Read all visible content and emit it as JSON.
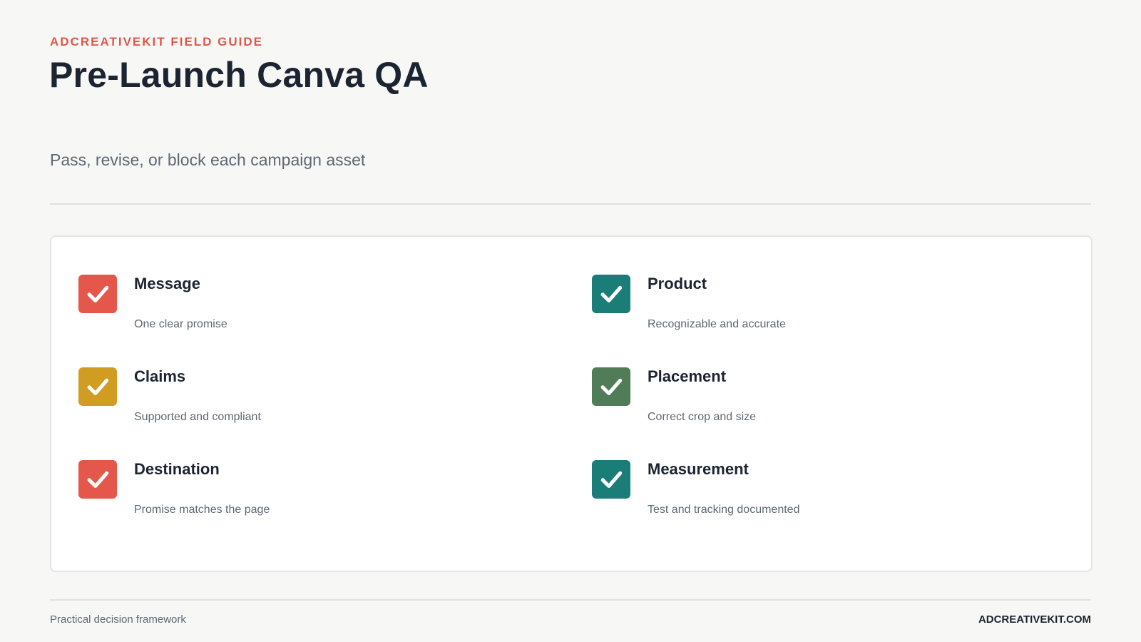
{
  "header": {
    "eyebrow": "ADCREATIVEKIT FIELD GUIDE",
    "title": "Pre-Launch Canva QA",
    "subtitle": "Pass, revise, or block each campaign asset"
  },
  "checklist": {
    "items": [
      {
        "label": "Message",
        "description": "One clear promise",
        "color": "#e5574a",
        "checked": true
      },
      {
        "label": "Claims",
        "description": "Supported and compliant",
        "color": "#d19c22",
        "checked": true
      },
      {
        "label": "Destination",
        "description": "Promise matches the page",
        "color": "#e5574a",
        "checked": true
      },
      {
        "label": "Product",
        "description": "Recognizable and accurate",
        "color": "#1b7d78",
        "checked": true
      },
      {
        "label": "Placement",
        "description": "Correct crop and size",
        "color": "#517c58",
        "checked": true
      },
      {
        "label": "Measurement",
        "description": "Test and tracking documented",
        "color": "#1b7d78",
        "checked": true
      }
    ]
  },
  "footer": {
    "left": "Practical decision framework",
    "right": "ADCREATIVEKIT.COM"
  },
  "colors": {
    "accent": "#e0574a",
    "background": "#f7f7f5",
    "text": "#1b2430",
    "muted": "#5e6874"
  },
  "icons": {
    "checkbox": "checkmark-icon"
  }
}
